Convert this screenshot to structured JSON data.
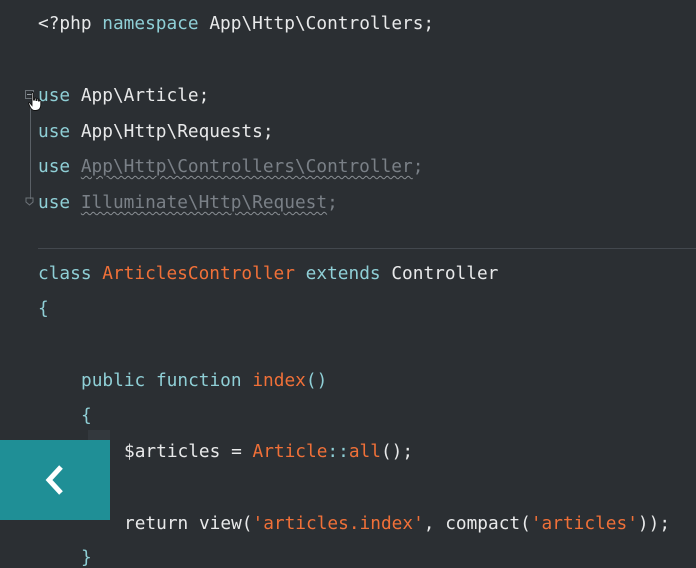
{
  "code": {
    "line_namespace": {
      "kw1": "<?php",
      "kw2": "namespace",
      "rest": "App\\Http\\Controllers;"
    },
    "use_article": {
      "kw": "use",
      "rest": "App\\Article;"
    },
    "use_requests": {
      "kw": "use",
      "rest": "App\\Http\\Requests;"
    },
    "use_controller": {
      "kw": "use",
      "rest": "App\\Http\\Controllers\\Controller",
      "semi": ";"
    },
    "use_request": {
      "kw": "use",
      "rest": "Illuminate\\Http\\Request",
      "semi": ";"
    },
    "class_decl": {
      "kw1": "class",
      "name": "ArticlesController",
      "kw2": "extends",
      "parent": "Controller"
    },
    "open_brace": "{",
    "method_decl": {
      "kw1": "public",
      "kw2": "function",
      "name": "index",
      "parens": "()"
    },
    "method_open": "{",
    "assign": {
      "var": "$articles",
      "op": " = ",
      "cls": "Article",
      "sep": "::",
      "fn": "all",
      "end": "();"
    },
    "return_stmt": {
      "kw": "return",
      "fn1": "view(",
      "str1": "'articles.index'",
      "mid": ", compact(",
      "str2": "'articles'",
      "end": "));"
    },
    "method_close": "}"
  },
  "icons": {
    "fold": "fold-collapse-icon",
    "cursor": "hand-pointer-icon",
    "back": "chevron-left-icon"
  },
  "colors": {
    "background": "#2b2f33",
    "keyword": "#8fcfd6",
    "function": "#f07038",
    "text": "#e8e9ea",
    "unused": "#7a8087",
    "back_button": "#1f8f96"
  }
}
